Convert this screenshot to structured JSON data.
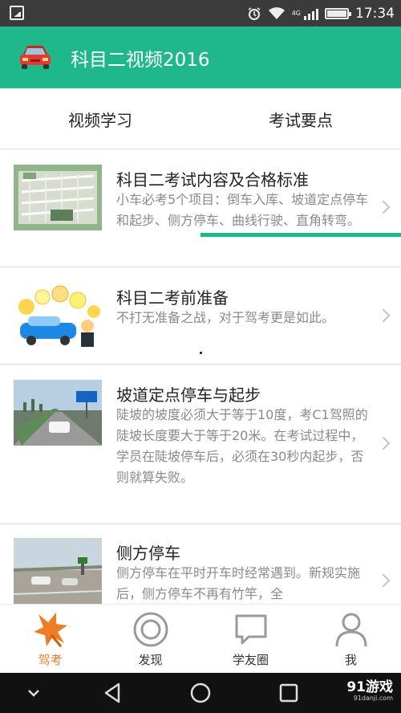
{
  "status_bar": {
    "time": "17:34",
    "network_label": "4G",
    "icons": [
      "image-icon",
      "alarm-icon",
      "wifi-icon",
      "signal-icon",
      "battery-icon"
    ]
  },
  "app_bar": {
    "title": "科目二视频2016",
    "logo_icon": "red-car-icon",
    "background_color": "#1fb88a"
  },
  "tabs": [
    {
      "label": "视频学习",
      "active": false
    },
    {
      "label": "考试要点",
      "active": true
    }
  ],
  "list": {
    "items": [
      {
        "title": "科目二考试内容及合格标准",
        "desc": "小车必考5个项目：倒车入库、坡道定点停车和起步、侧方停车、曲线行驶、直角转弯。",
        "thumb_icon": "exam-course-map-thumbnail"
      },
      {
        "title": "科目二考前准备",
        "desc": "不打无准备之战，对于驾考更是如此。",
        "thumb_icon": "police-car-illustration-thumbnail"
      },
      {
        "title": "坡道定点停车与起步",
        "desc": "陡坡的坡度必须大于等于10度，考C1驾照的陡坡长度要大于等于20米。在考试过程中，学员在陡坡停车后，必须在30秒内起步，否则就算失败。",
        "thumb_icon": "slope-road-photo-thumbnail"
      },
      {
        "title": "侧方停车",
        "desc": "侧方停车在平时开车时经常遇到。新规实施后，侧方停车不再有竹竿，全",
        "thumb_icon": "parking-lot-photo-thumbnail"
      }
    ]
  },
  "bottom_nav": [
    {
      "label": "驾考",
      "icon": "star-icon",
      "active": true
    },
    {
      "label": "发现",
      "icon": "target-icon",
      "active": false
    },
    {
      "label": "学友圈",
      "icon": "chat-bubble-icon",
      "active": false
    },
    {
      "label": "我",
      "icon": "person-icon",
      "active": false
    }
  ],
  "system_nav": {
    "buttons": [
      "chevron-down-icon",
      "back-icon",
      "home-icon",
      "recents-icon"
    ],
    "watermark": "91游戏",
    "watermark_sub": "91danji.com"
  },
  "colors": {
    "accent": "#1fb88a",
    "active_nav": "#ee7d25"
  }
}
